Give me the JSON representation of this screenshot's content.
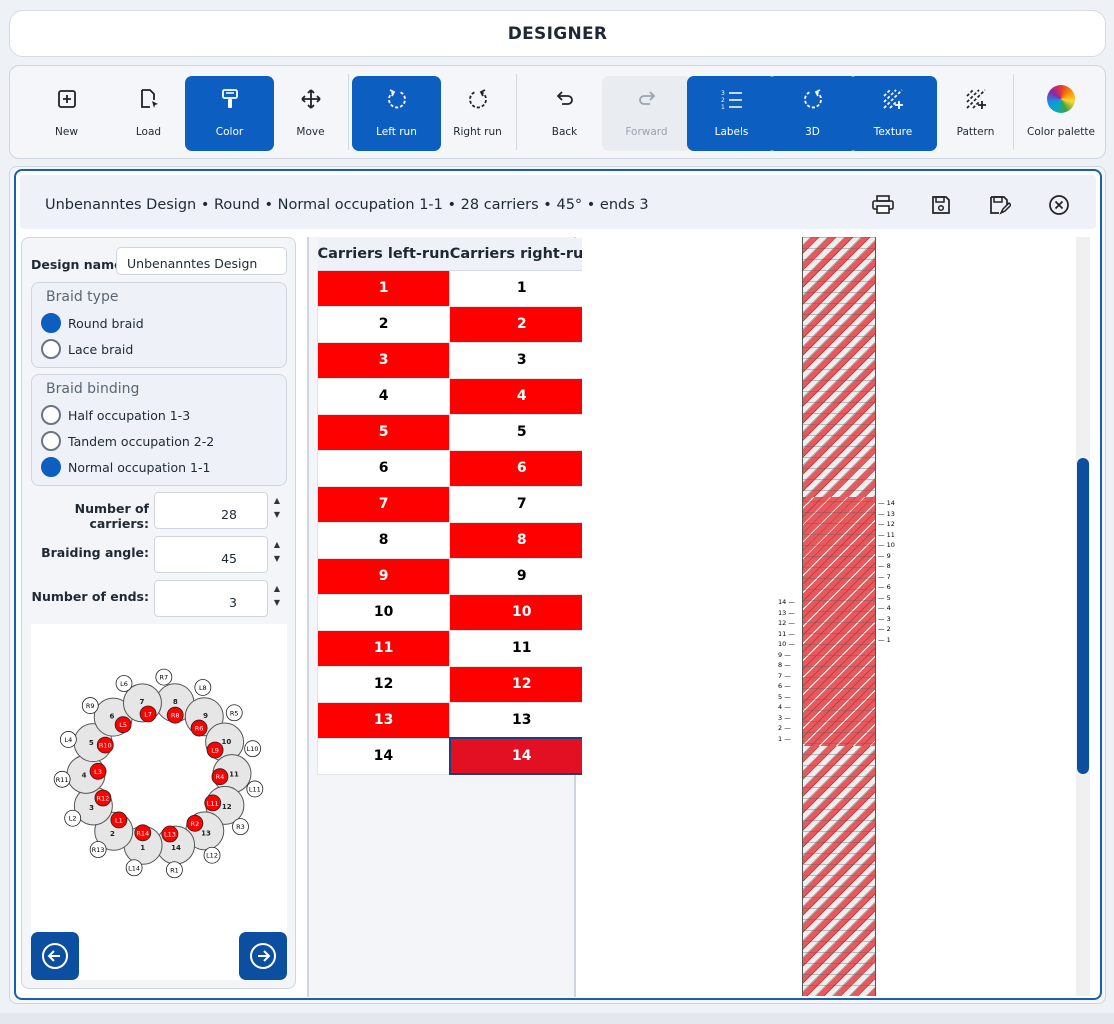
{
  "app": {
    "title": "DESIGNER"
  },
  "toolbar": {
    "new": "New",
    "load": "Load",
    "color": "Color",
    "move": "Move",
    "left_run": "Left run",
    "right_run": "Right run",
    "back": "Back",
    "forward": "Forward",
    "labels": "Labels",
    "three_d": "3D",
    "texture": "Texture",
    "pattern": "Pattern",
    "color_palette": "Color palette"
  },
  "header": {
    "summary": "Unbenanntes Design • Round • Normal occupation 1-1 • 28 carriers • 45° • ends 3"
  },
  "form": {
    "design_name_label": "Design name",
    "design_name_value": "Unbenanntes Design",
    "braid_type_title": "Braid type",
    "braid_types": [
      {
        "label": "Round braid",
        "selected": true
      },
      {
        "label": "Lace braid",
        "selected": false
      }
    ],
    "braid_binding_title": "Braid binding",
    "braid_bindings": [
      {
        "label": "Half occupation 1-3",
        "selected": false
      },
      {
        "label": "Tandem occupation 2-2",
        "selected": false
      },
      {
        "label": "Normal occupation 1-1",
        "selected": true
      }
    ],
    "carriers_label": "Number of carriers:",
    "carriers_value": "28",
    "angle_label": "Braiding angle:",
    "angle_value": "45",
    "ends_label": "Number of ends:",
    "ends_value": "3"
  },
  "diagram_labels": {
    "outer": [
      "R7",
      "L8",
      "R5",
      "L10",
      "L11",
      "R3",
      "L12",
      "R1",
      "L14",
      "R13",
      "L2",
      "R11",
      "L4",
      "R9",
      "L6"
    ],
    "inner_red": [
      "L7",
      "R8",
      "R6",
      "L9",
      "R4",
      "L11",
      "R2",
      "L13",
      "R14",
      "L1",
      "R12",
      "L3",
      "R10",
      "L5"
    ],
    "ring_numbers": [
      "8",
      "9",
      "10",
      "11",
      "12",
      "13",
      "14",
      "1",
      "2",
      "3",
      "4",
      "5",
      "6",
      "7"
    ]
  },
  "table": {
    "col_left": "Carriers left-run",
    "col_right": "Carriers right-run",
    "rows": [
      {
        "left": "1",
        "right": "1",
        "lc": "red",
        "rc": "white"
      },
      {
        "left": "2",
        "right": "2",
        "lc": "white",
        "rc": "red"
      },
      {
        "left": "3",
        "right": "3",
        "lc": "red",
        "rc": "white"
      },
      {
        "left": "4",
        "right": "4",
        "lc": "white",
        "rc": "red"
      },
      {
        "left": "5",
        "right": "5",
        "lc": "red",
        "rc": "white"
      },
      {
        "left": "6",
        "right": "6",
        "lc": "white",
        "rc": "red"
      },
      {
        "left": "7",
        "right": "7",
        "lc": "red",
        "rc": "white"
      },
      {
        "left": "8",
        "right": "8",
        "lc": "white",
        "rc": "red"
      },
      {
        "left": "9",
        "right": "9",
        "lc": "red",
        "rc": "white"
      },
      {
        "left": "10",
        "right": "10",
        "lc": "white",
        "rc": "red"
      },
      {
        "left": "11",
        "right": "11",
        "lc": "red",
        "rc": "white"
      },
      {
        "left": "12",
        "right": "12",
        "lc": "white",
        "rc": "red"
      },
      {
        "left": "13",
        "right": "13",
        "lc": "red",
        "rc": "white"
      },
      {
        "left": "14",
        "right": "14",
        "lc": "white",
        "rc": "sel"
      }
    ]
  },
  "view": {
    "right_marks": [
      "14",
      "13",
      "12",
      "11",
      "10",
      "9",
      "8",
      "7",
      "6",
      "5",
      "4",
      "3",
      "2",
      "1"
    ],
    "left_marks": [
      "14",
      "13",
      "12",
      "11",
      "10",
      "9",
      "8",
      "7",
      "6",
      "5",
      "4",
      "3",
      "2",
      "1"
    ]
  },
  "colors": {
    "accent": "#0c5fc0",
    "red": "#ff0000",
    "braid_red": "#e65a5e",
    "border": "#1a5fa8"
  }
}
